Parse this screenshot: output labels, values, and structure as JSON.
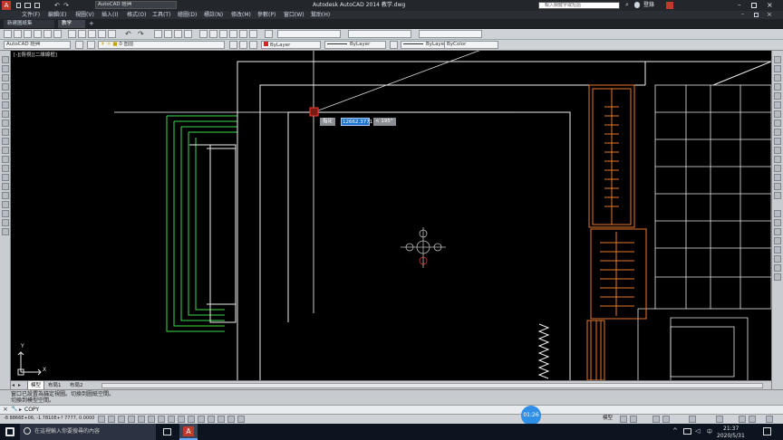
{
  "title_bar": {
    "workspace": "AutoCAD 經典",
    "window_title": "Autodesk AutoCAD 2014    教学.dwg",
    "search_placeholder": "輸入關鍵字或短語",
    "user": "登錄"
  },
  "menu": [
    "文件(F)",
    "編輯(E)",
    "視圖(V)",
    "插入(I)",
    "格式(O)",
    "工具(T)",
    "繪圖(D)",
    "標註(N)",
    "修改(M)",
    "參數(P)",
    "窗口(W)",
    "幫助(H)"
  ],
  "file_tabs": [
    {
      "label": "新建圖紙集",
      "active": false
    },
    {
      "label": "教学",
      "active": true
    }
  ],
  "toolbar": {
    "workspace_select": "AutoCAD 經典",
    "layer_select": "0 图层",
    "color_select": "ByLayer",
    "linetype_select": "ByLayer",
    "lineweight_select": "ByLayer",
    "plotstyle_select": "ByColor"
  },
  "viewport_label": "[-][俯視][二維線框]",
  "dynamic_input": {
    "prompt": "指定",
    "distance": "12662.3771",
    "angle": "195°"
  },
  "ucs": {
    "x": "X",
    "y": "Y"
  },
  "layout_tabs": [
    "模型",
    "布局1",
    "布局2"
  ],
  "command_history": [
    "窗口已設置為錨定視圖。切換到圖紙空間。",
    "切換到模型空間。"
  ],
  "command_line": "COPY",
  "status_coords": "-8 8866E+06, -1.7810E+? 7777, 0.0000",
  "status_model": "模型",
  "timer": "01:26",
  "taskbar": {
    "search_placeholder": "在這裡輸入你要搜尋的內容",
    "time": "21:37",
    "date": "2020/5/31"
  },
  "colors": {
    "background": "#000000",
    "wall_lines": "#ffffff",
    "green_lines": "#3ddc4a",
    "orange_lines": "#e8792b",
    "grip_red": "#ff3b30",
    "cursor": "#ffffff",
    "accent": "#2f8ee5"
  }
}
